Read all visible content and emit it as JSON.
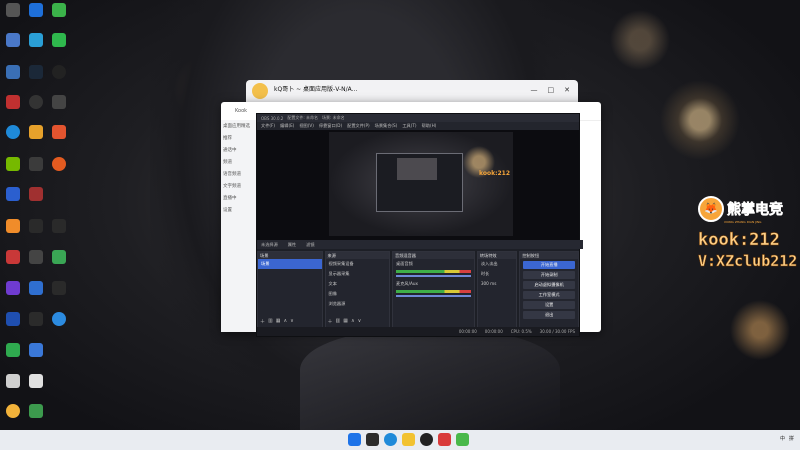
{
  "qq": {
    "title": "kQ哥卜 ~ 桌面应用版-V-N/A...",
    "ctrls": [
      "—",
      "□",
      "✕"
    ]
  },
  "kook": {
    "title": "Kook",
    "sidebar_rows": [
      "桌面应用精选",
      "推荐",
      "通话中",
      "频道",
      "语音频道",
      "文字频道",
      "直播中",
      "设置"
    ]
  },
  "obs": {
    "titlebar": [
      "OBS 30.0.2",
      "配置文件: 未命名",
      "场景: 未命名"
    ],
    "menu": [
      "文件(F)",
      "编辑(E)",
      "视图(V)",
      "停靠窗口(D)",
      "配置文件(P)",
      "场景集合(S)",
      "工具(T)",
      "帮助(H)"
    ],
    "preview_watermark": "kook:212",
    "scenebar": [
      "未选择源",
      "属性",
      "滤镜"
    ],
    "scenes": {
      "header": "场景",
      "items": [
        "场景"
      ]
    },
    "sources": {
      "header": "来源",
      "items": [
        "视频采集设备",
        "显示器采集",
        "文本",
        "图像",
        "浏览器源"
      ]
    },
    "mixer": {
      "header": "音频混音器",
      "channels": [
        "桌面音频",
        "麦克风/Aux"
      ],
      "levels": [
        "0.0 dB",
        "0.0 dB"
      ]
    },
    "transitions": {
      "header": "转场特效",
      "selected": "淡入淡出",
      "duration_label": "时长",
      "duration": "300 ms"
    },
    "controls": {
      "header": "控制按钮",
      "buttons": [
        "开始直播",
        "开始录制",
        "启动虚拟摄像机",
        "工作室模式",
        "设置",
        "退出"
      ]
    },
    "status": [
      "00:00:00",
      "00:00:00",
      "CPU: 0.5%",
      "30.00 / 30.00 FPS"
    ]
  },
  "watermark": {
    "title": "熊掌电竞",
    "subtitle": "XIONG ZHANG DIAN JING",
    "line1": "kook:212",
    "line2": "V:XZclub212"
  },
  "taskbar": {
    "tray": [
      "中",
      "拼"
    ]
  }
}
